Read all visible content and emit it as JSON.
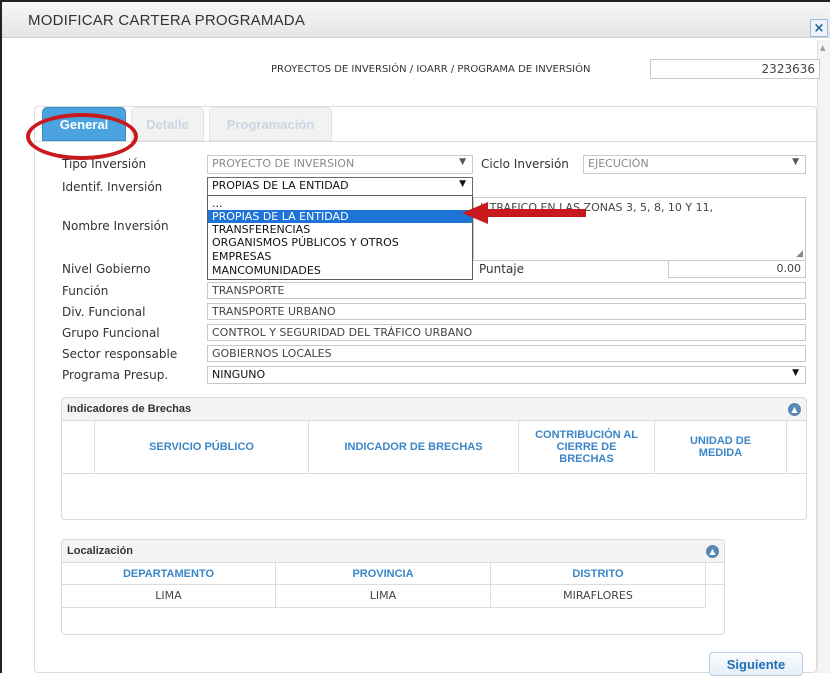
{
  "dialog": {
    "title": "MODIFICAR CARTERA PROGRAMADA",
    "close_icon": "×"
  },
  "header": {
    "breadcrumb": "PROYECTOS DE INVERSIÓN / IOARR / PROGRAMA DE INVERSIÓN",
    "code": "2323636"
  },
  "tabs": [
    {
      "label": "General",
      "active": true
    },
    {
      "label": "Detalle",
      "active": false
    },
    {
      "label": "Programación",
      "active": false
    }
  ],
  "form": {
    "tipo_inversion": {
      "label": "Tipo Inversión",
      "value": "PROYECTO DE INVERSION"
    },
    "ciclo_inversion": {
      "label": "Ciclo Inversión",
      "value": "EJECUCIÓN"
    },
    "identif_inversion": {
      "label": "Identif. Inversión",
      "value": "PROPIAS DE LA ENTIDAD",
      "options": [
        "...",
        "PROPIAS DE LA ENTIDAD",
        "TRANSFERENCIAS",
        "ORGANISMOS PÚBLICOS Y OTROS",
        "EMPRESAS",
        "MANCOMUNIDADES"
      ]
    },
    "nombre_inversion": {
      "label": "Nombre Inversión",
      "value_visible": "L         TRAFICO  EN LAS ZONAS 3, 5, 8, 10 Y 11,"
    },
    "nivel_gobierno": {
      "label": "Nivel Gobierno"
    },
    "puntaje": {
      "label": "Puntaje",
      "value": "0.00"
    },
    "funcion": {
      "label": "Función",
      "value": "TRANSPORTE"
    },
    "div_funcional": {
      "label": "Div. Funcional",
      "value": "TRANSPORTE URBANO"
    },
    "grupo_funcional": {
      "label": "Grupo Funcional",
      "value": "CONTROL Y SEGURIDAD DEL TRÁFICO URBANO"
    },
    "sector_responsable": {
      "label": "Sector responsable",
      "value": "GOBIERNOS LOCALES"
    },
    "programa_presup": {
      "label": "Programa Presup.",
      "value": "NINGUNO"
    }
  },
  "brechas": {
    "title": "Indicadores de Brechas",
    "columns": [
      "SERVICIO PÚBLICO",
      "INDICADOR DE BRECHAS",
      "CONTRIBUCIÓN AL CIERRE DE BRECHAS",
      "UNIDAD DE MEDIDA"
    ]
  },
  "localizacion": {
    "title": "Localización",
    "columns": [
      "DEPARTAMENTO",
      "PROVINCIA",
      "DISTRITO"
    ],
    "rows": [
      [
        "LIMA",
        "LIMA",
        "MIRAFLORES"
      ]
    ]
  },
  "footer": {
    "next_label": "Siguiente"
  },
  "colors": {
    "tab_active": "#4aa3df",
    "highlight": "#c8191e",
    "selected_option": "#1e73d6",
    "header_text": "#3b86c7"
  }
}
